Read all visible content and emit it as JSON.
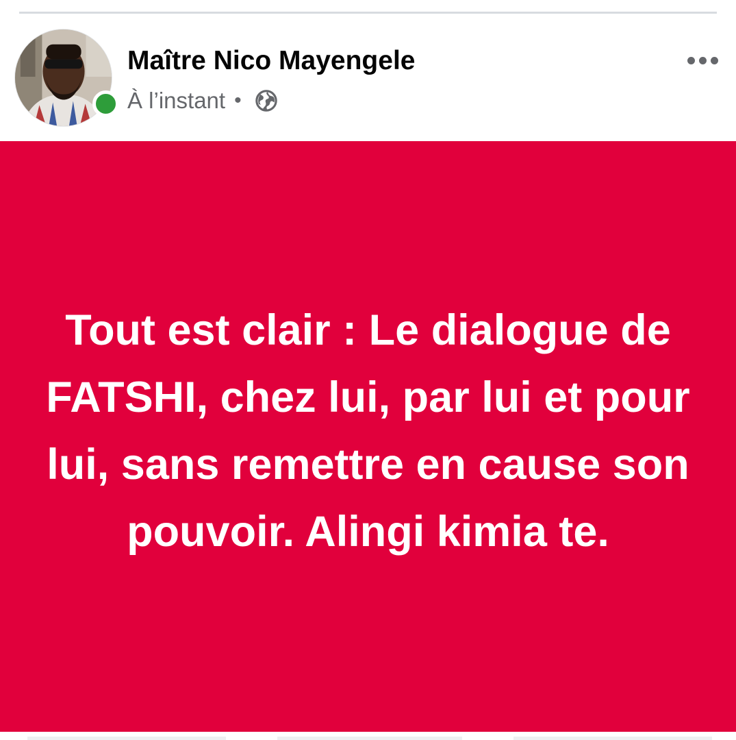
{
  "post": {
    "author": {
      "name": "Maître Nico Mayengele",
      "avatar_icon": "profile-photo",
      "online_status_color": "#2e9d3a"
    },
    "timestamp": "À l’instant",
    "separator": "•",
    "audience_icon": "globe-icon",
    "more_icon": "more-options-icon",
    "background_color": "#e1003c",
    "text": "Tout est clair : Le dialogue de FATSHI, chez lui, par lui et pour lui, sans remettre en cause son pouvoir. Alingi kimia te."
  }
}
